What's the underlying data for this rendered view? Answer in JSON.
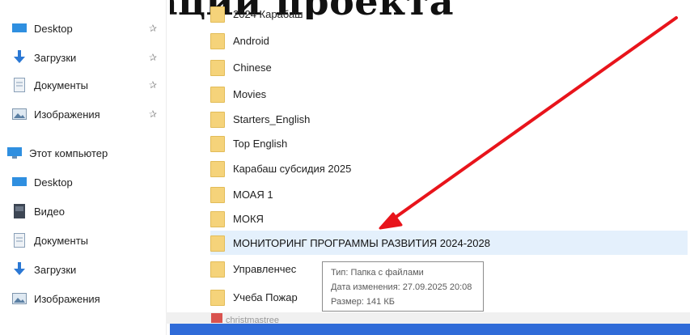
{
  "heading": {
    "text": "ализации проекта"
  },
  "sidebar": {
    "items": [
      {
        "label": "Desktop",
        "icon": "desktop-icon",
        "pinned": true
      },
      {
        "label": "Загрузки",
        "icon": "download-icon",
        "pinned": true
      },
      {
        "label": "Документы",
        "icon": "documents-icon",
        "pinned": true
      },
      {
        "label": "Изображения",
        "icon": "pictures-icon",
        "pinned": true
      },
      {
        "label": "Этот компьютер",
        "icon": "computer-icon",
        "pinned": false
      },
      {
        "label": "Desktop",
        "icon": "desktop-icon",
        "pinned": false
      },
      {
        "label": "Видео",
        "icon": "video-icon",
        "pinned": false
      },
      {
        "label": "Документы",
        "icon": "documents-icon",
        "pinned": false
      },
      {
        "label": "Загрузки",
        "icon": "download-icon",
        "pinned": false
      },
      {
        "label": "Изображения",
        "icon": "pictures-icon",
        "pinned": false
      }
    ],
    "pin_glyph": "✰"
  },
  "files": {
    "items": [
      {
        "name": "2024 Карабаш"
      },
      {
        "name": "Android"
      },
      {
        "name": "Chinese"
      },
      {
        "name": "Movies"
      },
      {
        "name": "Starters_English"
      },
      {
        "name": "Top English"
      },
      {
        "name": "Карабаш субсидия 2025"
      },
      {
        "name": "МОАЯ 1"
      },
      {
        "name": "МОКЯ"
      },
      {
        "name": "МОНИТОРИНГ ПРОГРАММЫ РАЗВИТИЯ 2024-2028",
        "selected": true
      },
      {
        "name": "Управленчес"
      },
      {
        "name": "Учеба Пожар"
      }
    ],
    "partial_last": "christmastree"
  },
  "tooltip": {
    "type": "Тип: Папка с файлами",
    "modified": "Дата изменения: 27.09.2025 20:08",
    "size": "Размер: 141 КБ"
  },
  "colors": {
    "arrow": "#e8141b",
    "folder": "#f5d37a",
    "selection": "#e4f0fc",
    "taskbar": "#2f6bd8"
  }
}
